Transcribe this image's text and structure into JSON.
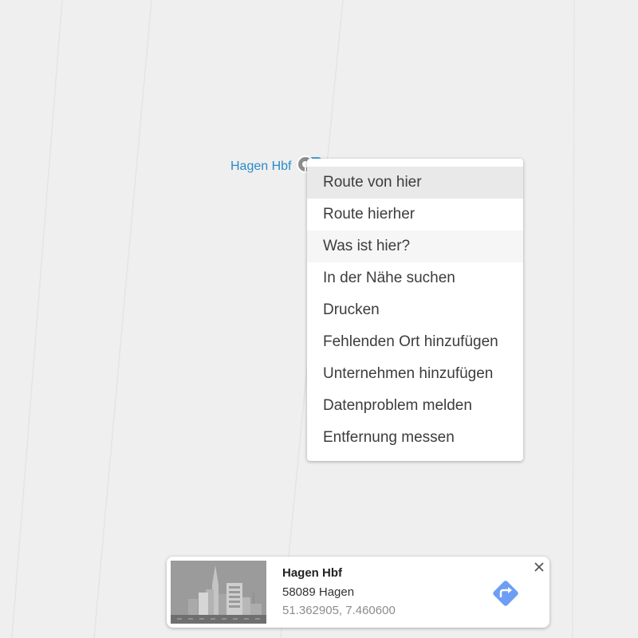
{
  "map": {
    "place_label": "Hagen Hbf"
  },
  "context_menu": {
    "items": [
      {
        "label": "Route von hier",
        "state": "active"
      },
      {
        "label": "Route hierher",
        "state": ""
      },
      {
        "label": "Was ist hier?",
        "state": "hover"
      },
      {
        "label": "In der Nähe suchen",
        "state": ""
      },
      {
        "label": "Drucken",
        "state": ""
      },
      {
        "label": "Fehlenden Ort hinzufügen",
        "state": ""
      },
      {
        "label": "Unternehmen hinzufügen",
        "state": ""
      },
      {
        "label": "Datenproblem melden",
        "state": ""
      },
      {
        "label": "Entfernung messen",
        "state": ""
      }
    ]
  },
  "info_card": {
    "title": "Hagen Hbf",
    "address": "58089 Hagen",
    "coordinates": "51.362905, 7.460600"
  },
  "icons": {
    "pin": "transit-pin-icon",
    "directions": "directions-icon",
    "close": "close-icon",
    "thumbnail": "city-illustration-icon"
  },
  "colors": {
    "place_label": "#2a8bc9",
    "directions": "#6d9ef5",
    "menu_active": "#e8e9e8",
    "menu_hover": "#f5f6f5"
  }
}
